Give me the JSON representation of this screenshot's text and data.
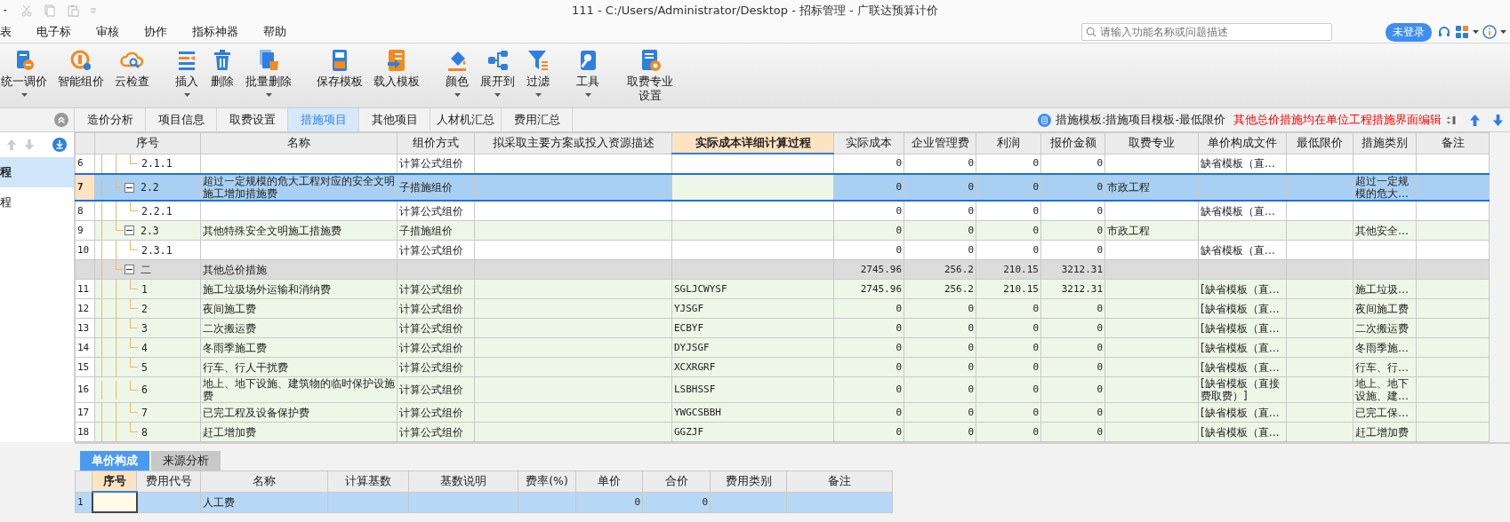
{
  "window": {
    "title": "111 - C:/Users/Administrator/Desktop - 招标管理 - 广联达预算计价"
  },
  "menu": [
    "表",
    "电子标",
    "审核",
    "协作",
    "指标神器",
    "帮助"
  ],
  "search": {
    "placeholder": "请输入功能名称或问题描述"
  },
  "login_button": "未登录",
  "toolbar": [
    [
      {
        "label": "统一调价",
        "menu": true
      },
      {
        "label": "智能组价",
        "menu": false
      },
      {
        "label": "云检查",
        "menu": false
      }
    ],
    [
      {
        "label": "插入",
        "menu": true
      },
      {
        "label": "删除",
        "menu": false
      },
      {
        "label": "批量删除",
        "menu": true
      }
    ],
    [
      {
        "label": "保存模板",
        "menu": false
      },
      {
        "label": "载入模板",
        "menu": false
      }
    ],
    [
      {
        "label": "颜色",
        "menu": true
      },
      {
        "label": "展开到",
        "menu": true
      },
      {
        "label": "过滤",
        "menu": true
      }
    ],
    [
      {
        "label": "工具",
        "menu": true
      }
    ],
    [
      {
        "label": "取费专业设置",
        "menu": false
      }
    ]
  ],
  "tabs": [
    {
      "label": "造价分析",
      "selected": false
    },
    {
      "label": "项目信息",
      "selected": false
    },
    {
      "label": "取费设置",
      "selected": false
    },
    {
      "label": "措施项目",
      "selected": true
    },
    {
      "label": "其他项目",
      "selected": false
    },
    {
      "label": "人材机汇总",
      "selected": false
    },
    {
      "label": "费用汇总",
      "selected": false
    }
  ],
  "template_info": "措施模板:措施项目模板-最低限价",
  "notice": "其他总价措施均在单位工程措施界面编辑",
  "sidebar": {
    "items": [
      {
        "label": "程",
        "selected": true
      },
      {
        "label": "程",
        "selected": false
      }
    ]
  },
  "table": {
    "columns": [
      {
        "label": "序号",
        "selected": false
      },
      {
        "label": "名称",
        "selected": false
      },
      {
        "label": "组价方式",
        "selected": false
      },
      {
        "label": "拟采取主要方案或投入资源描述",
        "selected": false
      },
      {
        "label": "实际成本详细计算过程",
        "selected": true
      },
      {
        "label": "实际成本",
        "selected": false
      },
      {
        "label": "企业管理费",
        "selected": false
      },
      {
        "label": "利润",
        "selected": false
      },
      {
        "label": "报价金额",
        "selected": false
      },
      {
        "label": "取费专业",
        "selected": false
      },
      {
        "label": "单价构成文件",
        "selected": false
      },
      {
        "label": "最低限价",
        "selected": false
      },
      {
        "label": "措施类别",
        "selected": false
      },
      {
        "label": "备注",
        "selected": false
      }
    ],
    "rows": [
      {
        "kind": "detail",
        "selected": false,
        "num": "6",
        "seq": "2.1.1",
        "method": "计算公式组价",
        "cost": "0",
        "mgmt": "0",
        "profit": "0",
        "quote": "0",
        "file": "缺省模板（直…"
      },
      {
        "kind": "measure",
        "selected": true,
        "expanded": true,
        "num": "7",
        "seq": "2.2",
        "name": "超过一定规模的危大工程对应的安全文明施工增加措施费",
        "method": "子措施组价",
        "cost": "0",
        "mgmt": "0",
        "profit": "0",
        "quote": "0",
        "specialty": "市政工程",
        "category": "超过一定规模的危大…",
        "children": [
          {
            "kind": "detail",
            "selected": false,
            "num": "8",
            "seq": "2.2.1",
            "method": "计算公式组价",
            "cost": "0",
            "mgmt": "0",
            "profit": "0",
            "quote": "0",
            "file": "缺省模板（直…"
          }
        ]
      },
      {
        "kind": "measure",
        "selected": false,
        "expanded": true,
        "num": "9",
        "seq": "2.3",
        "name": "其他特殊安全文明施工措施费",
        "method": "子措施组价",
        "cost": "0",
        "mgmt": "0",
        "profit": "0",
        "quote": "0",
        "specialty": "市政工程",
        "category": "其他安全…",
        "children": [
          {
            "kind": "detail",
            "selected": false,
            "num": "10",
            "seq": "2.3.1",
            "method": "计算公式组价",
            "cost": "0",
            "mgmt": "0",
            "profit": "0",
            "quote": "0",
            "file": "缺省模板（直…"
          }
        ]
      },
      {
        "kind": "group",
        "selected": false,
        "expanded": true,
        "seq": "二",
        "name": "其他总价措施",
        "cost": "2745.96",
        "mgmt": "256.2",
        "profit": "210.15",
        "quote": "3212.31",
        "children": [
          {
            "kind": "item",
            "selected": false,
            "num": "11",
            "seq": "1",
            "name": "施工垃圾场外运输和消纳费",
            "method": "计算公式组价",
            "calc": "SGLJCWYSF",
            "cost": "2745.96",
            "mgmt": "256.2",
            "profit": "210.15",
            "quote": "3212.31",
            "file": "[缺省模板（直…",
            "category": "施工垃圾…"
          },
          {
            "kind": "item",
            "selected": false,
            "num": "12",
            "seq": "2",
            "name": "夜间施工费",
            "method": "计算公式组价",
            "calc": "YJSGF",
            "cost": "0",
            "mgmt": "0",
            "profit": "0",
            "quote": "0",
            "file": "[缺省模板（直…",
            "category": "夜间施工费"
          },
          {
            "kind": "item",
            "selected": false,
            "num": "13",
            "seq": "3",
            "name": "二次搬运费",
            "method": "计算公式组价",
            "calc": "ECBYF",
            "cost": "0",
            "mgmt": "0",
            "profit": "0",
            "quote": "0",
            "file": "[缺省模板（直…",
            "category": "二次搬运费"
          },
          {
            "kind": "item",
            "selected": false,
            "num": "14",
            "seq": "4",
            "name": "冬雨季施工费",
            "method": "计算公式组价",
            "calc": "DYJSGF",
            "cost": "0",
            "mgmt": "0",
            "profit": "0",
            "quote": "0",
            "file": "[缺省模板（直…",
            "category": "冬雨季施…"
          },
          {
            "kind": "item",
            "selected": false,
            "num": "15",
            "seq": "5",
            "name": "行车、行人干扰费",
            "method": "计算公式组价",
            "calc": "XCXRGRF",
            "cost": "0",
            "mgmt": "0",
            "profit": "0",
            "quote": "0",
            "file": "[缺省模板（直…",
            "category": "行车、行…"
          },
          {
            "kind": "item",
            "selected": false,
            "num": "16",
            "seq": "6",
            "name": "地上、地下设施、建筑物的临时保护设施费",
            "method": "计算公式组价",
            "calc": "LSBHSSF",
            "cost": "0",
            "mgmt": "0",
            "profit": "0",
            "quote": "0",
            "file": "[缺省模板（直接费取费）]",
            "category": "地上、地下设施、建…"
          },
          {
            "kind": "item",
            "selected": false,
            "num": "17",
            "seq": "7",
            "name": "已完工程及设备保护费",
            "method": "计算公式组价",
            "calc": "YWGCSBBH",
            "cost": "0",
            "mgmt": "0",
            "profit": "0",
            "quote": "0",
            "file": "[缺省模板（直…",
            "category": "已完工保…"
          },
          {
            "kind": "item",
            "selected": false,
            "num": "18",
            "seq": "8",
            "name": "赶工增加费",
            "method": "计算公式组价",
            "calc": "GGZJF",
            "cost": "0",
            "mgmt": "0",
            "profit": "0",
            "quote": "0",
            "file": "[缺省模板（直…",
            "category": "赶工增加费"
          }
        ]
      }
    ]
  },
  "bottom_tabs": [
    {
      "label": "单价构成",
      "selected": true
    },
    {
      "label": "来源分析",
      "selected": false
    }
  ],
  "bottom_table": {
    "columns": [
      {
        "label": "序号",
        "selected": true
      },
      {
        "label": "费用代号",
        "selected": false
      },
      {
        "label": "名称",
        "selected": false
      },
      {
        "label": "计算基数",
        "selected": false
      },
      {
        "label": "基数说明",
        "selected": false
      },
      {
        "label": "费率(%)",
        "selected": false
      },
      {
        "label": "单价",
        "selected": false
      },
      {
        "label": "合价",
        "selected": false
      },
      {
        "label": "费用类别",
        "selected": false
      },
      {
        "label": "备注",
        "selected": false
      }
    ],
    "rows": [
      {
        "selected": true,
        "num": "1",
        "name": "人工费",
        "unit_price": "0",
        "total": "0"
      }
    ]
  }
}
